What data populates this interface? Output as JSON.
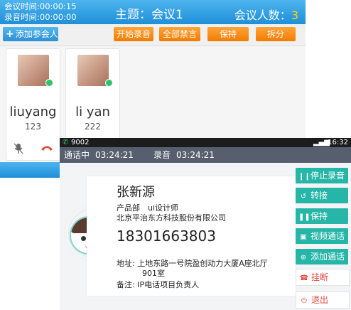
{
  "conference": {
    "time_label": "会议时间:00:00:15",
    "record_label": "录音时间:00:00:00",
    "topic": "主题：会议1",
    "count_label": "会议人数：",
    "count_value": "3",
    "toolbar": {
      "add_label": "添加参会人",
      "start_record": "开始录音",
      "mute_all": "全部禁言",
      "hold": "保持",
      "split": "拆分"
    },
    "participants": [
      {
        "name": "liuyang",
        "ext": "123"
      },
      {
        "name": "li yan",
        "ext": "222"
      }
    ]
  },
  "call": {
    "status_bar": {
      "number": "9002",
      "time": "16:32"
    },
    "call_state": "通话中",
    "call_duration": "03:24:21",
    "record_label": "录音",
    "record_duration": "03:24:21",
    "contact": {
      "name": "张新源",
      "dept_title": "产品部　ui设计师",
      "company": "北京平治东方科技股份有限公司",
      "phone": "18301663803",
      "address_label": "地址:",
      "address_line1": "上地东路一号院盈创动力大厦A座北厅",
      "address_line2": "901室",
      "note_label": "备注:",
      "note": "IP电话项目负责人"
    },
    "actions": {
      "stop_record": "停止录音",
      "transfer": "转接",
      "hold": "保持",
      "video_call": "视频通话",
      "add_call": "添加通话",
      "hangup": "挂断",
      "exit": "退出"
    }
  },
  "colors": {
    "accent_blue": "#2a9be3",
    "orange": "#f58a12",
    "teal": "#26b6a7",
    "red": "#e5463c",
    "callbar": "#575f6e"
  }
}
